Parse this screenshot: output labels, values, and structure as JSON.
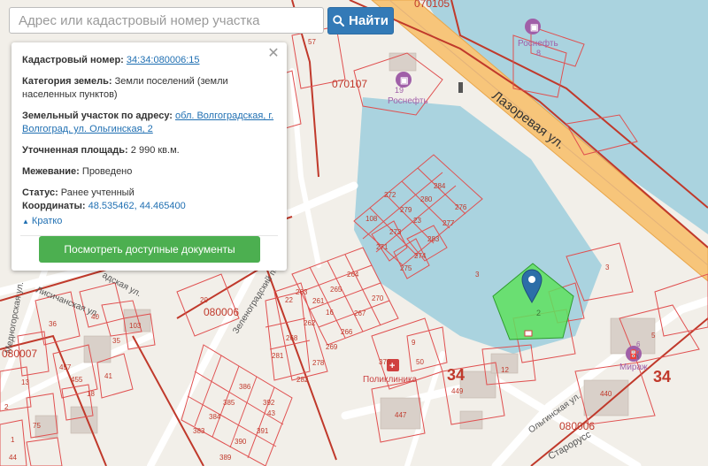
{
  "search": {
    "placeholder": "Адрес или кадастровый номер участка",
    "button_label": "Найти"
  },
  "popup": {
    "cadastral_label": "Кадастровый номер:",
    "cadastral_value": "34:34:080006:15",
    "category_label": "Категория земель:",
    "category_value": "Земли поселений (земли населенных пунктов)",
    "address_label": "Земельный участок по адресу:",
    "address_value": "обл. Волгоградская, г. Волгоград, ул. Ольгинская, 2",
    "area_label": "Уточненная площадь:",
    "area_value": "2 990 кв.м.",
    "survey_label": "Межевание:",
    "survey_value": "Проведено",
    "status_label": "Статус:",
    "status_value": "Ранее учтенный",
    "coords_label": "Координаты:",
    "coords_value": "48.535462, 44.465400",
    "collapse_label": "Кратко",
    "docs_button_label": "Посмотреть доступные документы"
  },
  "map": {
    "streets": {
      "lazorevaya": "Лазоревая ул.",
      "zelenogradsky": "Зеленоградский пер.",
      "olginskaya": "Ольгинская ул.",
      "lisichanskaya": "Лисичанская ул.",
      "pushkinskaya": "адская ул.",
      "mednogorskaya": "Медногорская ул.",
      "starorus": "Старорусс"
    },
    "pois": {
      "rosneft1": "Роснефть",
      "rosneft1_num": "8",
      "rosneft2": "Роснефть",
      "rosneft2_num": "19",
      "mirazh": "Мираж",
      "mirazh_num": "6",
      "polyclinic": "Поликлиника"
    },
    "districts": {
      "d070105": "070105",
      "d070107": "070107",
      "d080006a": "080006",
      "d080006b": "080006",
      "d080007": "080007",
      "q34a": "34",
      "q34b": "34"
    },
    "selected_parcel_label": "2",
    "labels": {
      "l57": "57",
      "l284": "284",
      "l276": "276",
      "l280": "280",
      "l272": "272",
      "l279": "279",
      "l277": "277",
      "l108": "108",
      "l273": "273",
      "l23": "23",
      "l283": "283",
      "l271": "271",
      "l274": "274",
      "l275": "275",
      "l3": "3",
      "l264": "264",
      "l263": "263",
      "l265": "265",
      "l270": "270",
      "l261": "261",
      "l16": "16",
      "l267": "267",
      "l262": "262",
      "l266": "266",
      "l268": "268",
      "l269": "269",
      "l281": "281",
      "l278": "278",
      "l282": "282",
      "l22": "22",
      "l20": "20",
      "l9": "9",
      "l50": "50",
      "l378": "378",
      "l12": "12",
      "l449": "449",
      "l447": "447",
      "l440": "440",
      "l5": "5",
      "l3b": "3",
      "l386": "386",
      "l385": "385",
      "l392": "392",
      "l43": "43",
      "l384": "384",
      "l391": "391",
      "l383": "383",
      "l390": "390",
      "l389": "389",
      "l40": "40",
      "l36": "36",
      "l103": "103",
      "l35": "35",
      "l41": "41",
      "l457": "457",
      "l455": "455",
      "l18": "18",
      "l13": "13",
      "l75": "75",
      "l2": "2",
      "l1": "1",
      "l44": "44"
    }
  }
}
